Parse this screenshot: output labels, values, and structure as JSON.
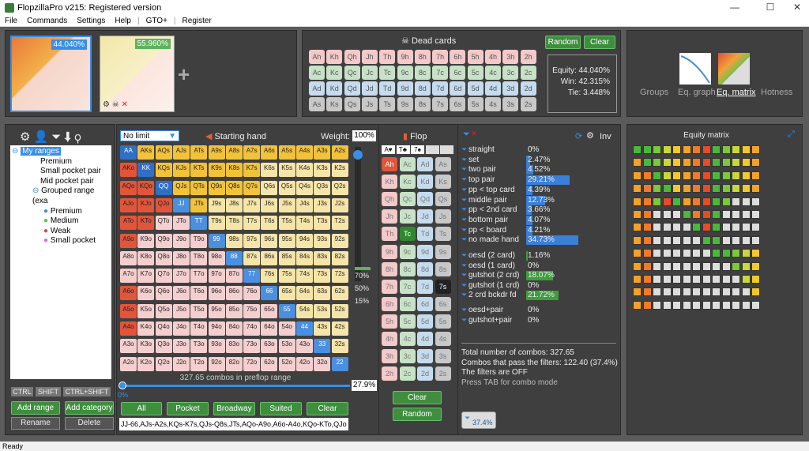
{
  "window": {
    "title": "FlopzillaPro v215: Registered version"
  },
  "menu": [
    "File",
    "Commands",
    "Settings",
    "Help",
    "GTO+",
    "Register"
  ],
  "ranges_top": {
    "range1_pct": "44.040%",
    "range2_pct": "55.960%",
    "add_symbol": "+"
  },
  "dead_cards": {
    "title": "Dead cards",
    "random": "Random",
    "clear": "Clear",
    "rows": [
      [
        "Ah",
        "Kh",
        "Qh",
        "Jh",
        "Th",
        "9h",
        "8h",
        "7h",
        "6h",
        "5h",
        "4h",
        "3h",
        "2h"
      ],
      [
        "Ac",
        "Kc",
        "Qc",
        "Jc",
        "Tc",
        "9c",
        "8c",
        "7c",
        "6c",
        "5c",
        "4c",
        "3c",
        "2c"
      ],
      [
        "Ad",
        "Kd",
        "Qd",
        "Jd",
        "Td",
        "9d",
        "8d",
        "7d",
        "6d",
        "5d",
        "4d",
        "3d",
        "2d"
      ],
      [
        "As",
        "Ks",
        "Qs",
        "Js",
        "Ts",
        "9s",
        "8s",
        "7s",
        "6s",
        "5s",
        "4s",
        "3s",
        "2s"
      ]
    ],
    "equity": "Equity: 44.040%",
    "win": "Win: 42.315%",
    "tie": "Tie: 3.448%"
  },
  "views": [
    "Groups",
    "Eq. graph",
    "Eq. matrix",
    "Hotness"
  ],
  "tree": {
    "root": "My ranges",
    "items": [
      "Premium",
      "Small pocket pair",
      "Mid pocket pair"
    ],
    "group": "Grouped range (exa",
    "subs": [
      "Premium",
      "Medium",
      "Weak",
      "Small pocket"
    ],
    "sub_colors": [
      "#3a8ee6",
      "#5cc15c",
      "#e04848",
      "#d86ad8"
    ]
  },
  "mods": [
    "CTRL",
    "SHIFT",
    "CTRL+SHIFT"
  ],
  "left_btns": [
    "Add range",
    "Add category",
    "Rename",
    "Delete"
  ],
  "range_panel": {
    "mode": "No limit",
    "title": "Starting hand",
    "weight_label": "Weight:",
    "weight": "100%",
    "combos": "327.65 combos in preflop range",
    "slider_pct": "0%",
    "pct_right": "27.9%",
    "scale": [
      "70%",
      "50%",
      "15%"
    ],
    "grid": [
      [
        "AA",
        "AKs",
        "AQs",
        "AJs",
        "ATs",
        "A9s",
        "A8s",
        "A7s",
        "A6s",
        "A5s",
        "A4s",
        "A3s",
        "A2s"
      ],
      [
        "AKo",
        "KK",
        "KQs",
        "KJs",
        "KTs",
        "K9s",
        "K8s",
        "K7s",
        "K6s",
        "K5s",
        "K4s",
        "K3s",
        "K2s"
      ],
      [
        "AQo",
        "KQo",
        "QQ",
        "QJs",
        "QTs",
        "Q9s",
        "Q8s",
        "Q7s",
        "Q6s",
        "Q5s",
        "Q4s",
        "Q3s",
        "Q2s"
      ],
      [
        "AJo",
        "KJo",
        "QJo",
        "JJ",
        "JTs",
        "J9s",
        "J8s",
        "J7s",
        "J6s",
        "J5s",
        "J4s",
        "J3s",
        "J2s"
      ],
      [
        "ATo",
        "KTo",
        "QTo",
        "JTo",
        "TT",
        "T9s",
        "T8s",
        "T7s",
        "T6s",
        "T5s",
        "T4s",
        "T3s",
        "T2s"
      ],
      [
        "A9o",
        "K9o",
        "Q9o",
        "J9o",
        "T9o",
        "99",
        "98s",
        "97s",
        "96s",
        "95s",
        "94s",
        "93s",
        "92s"
      ],
      [
        "A8o",
        "K8o",
        "Q8o",
        "J8o",
        "T8o",
        "98o",
        "88",
        "87s",
        "86s",
        "85s",
        "84s",
        "83s",
        "82s"
      ],
      [
        "A7o",
        "K7o",
        "Q7o",
        "J7o",
        "T7o",
        "97o",
        "87o",
        "77",
        "76s",
        "75s",
        "74s",
        "73s",
        "72s"
      ],
      [
        "A6o",
        "K6o",
        "Q6o",
        "J6o",
        "T6o",
        "96o",
        "86o",
        "76o",
        "66",
        "65s",
        "64s",
        "63s",
        "62s"
      ],
      [
        "A5o",
        "K5o",
        "Q5o",
        "J5o",
        "T5o",
        "95o",
        "85o",
        "75o",
        "65o",
        "55",
        "54s",
        "53s",
        "52s"
      ],
      [
        "A4o",
        "K4o",
        "Q4o",
        "J4o",
        "T4o",
        "94o",
        "84o",
        "74o",
        "64o",
        "54o",
        "44",
        "43s",
        "42s"
      ],
      [
        "A3o",
        "K3o",
        "Q3o",
        "J3o",
        "T3o",
        "93o",
        "83o",
        "73o",
        "63o",
        "53o",
        "43o",
        "33",
        "32s"
      ],
      [
        "A2o",
        "K2o",
        "Q2o",
        "J2o",
        "T2o",
        "92o",
        "82o",
        "72o",
        "62o",
        "52o",
        "42o",
        "32o",
        "22"
      ]
    ],
    "bottom_btns": [
      "All",
      "Pocket",
      "Broadway",
      "Suited",
      "Clear"
    ],
    "range_text": "JJ-66,AJs-A2s,KQs-K7s,QJs-Q8s,JTs,AQo-A9o,A6o-A4o,KQo-KTo,QJo"
  },
  "flop": {
    "title": "Flop",
    "board": [
      "A♥",
      "T♣",
      "7♠",
      "",
      ""
    ],
    "cols": [
      [
        "Ah",
        "Kh",
        "Qh",
        "Jh",
        "Th",
        "9h",
        "8h",
        "7h",
        "6h",
        "5h",
        "4h",
        "3h",
        "2h"
      ],
      [
        "Ac",
        "Kc",
        "Qc",
        "Jc",
        "Tc",
        "9c",
        "8c",
        "7c",
        "6c",
        "5c",
        "4c",
        "3c",
        "2c"
      ],
      [
        "Ad",
        "Kd",
        "Qd",
        "Jd",
        "Td",
        "9d",
        "8d",
        "7d",
        "6d",
        "5d",
        "4d",
        "3d",
        "2d"
      ],
      [
        "As",
        "Ks",
        "Qs",
        "Js",
        "Ts",
        "9s",
        "8s",
        "7s",
        "6s",
        "5s",
        "4s",
        "3s",
        "2s"
      ]
    ],
    "clear": "Clear",
    "random": "Random"
  },
  "stats": {
    "inv": "Inv",
    "rows": [
      {
        "l": "straight",
        "v": "0%",
        "p": 0
      },
      {
        "l": "set",
        "v": "2.47%",
        "p": 2.47
      },
      {
        "l": "two pair",
        "v": "4.52%",
        "p": 4.52
      },
      {
        "l": "top pair",
        "v": "29.21%",
        "p": 29.21
      },
      {
        "l": "pp < top card",
        "v": "4.39%",
        "p": 4.39
      },
      {
        "l": "middle pair",
        "v": "12.73%",
        "p": 12.73
      },
      {
        "l": "pp < 2nd card",
        "v": "3.66%",
        "p": 3.66
      },
      {
        "l": "bottom pair",
        "v": "4.07%",
        "p": 4.07
      },
      {
        "l": "pp < board",
        "v": "4.21%",
        "p": 4.21
      },
      {
        "l": "no made hand",
        "v": "34.73%",
        "p": 34.73
      }
    ],
    "draws": [
      {
        "l": "oesd (2 card)",
        "v": "1.16%",
        "p": 1.16
      },
      {
        "l": "oesd (1 card)",
        "v": "0%",
        "p": 0
      },
      {
        "l": "gutshot (2 crd)",
        "v": "18.07%",
        "p": 18.07
      },
      {
        "l": "gutshot (1 crd)",
        "v": "0%",
        "p": 0
      },
      {
        "l": "2 crd bckdr fd",
        "v": "21.72%",
        "p": 21.72
      }
    ],
    "combo": [
      {
        "l": "oesd+pair",
        "v": "0%"
      },
      {
        "l": "gutshot+pair",
        "v": "0%"
      }
    ],
    "summary": [
      "Total number of combos: 327.65",
      "Combos that pass the filters: 122.40 (37.4%)",
      "The filters are OFF",
      "Press TAB for combo mode"
    ],
    "badge": "37.4%"
  },
  "matrix": {
    "title": "Equity matrix"
  },
  "status": "Ready"
}
